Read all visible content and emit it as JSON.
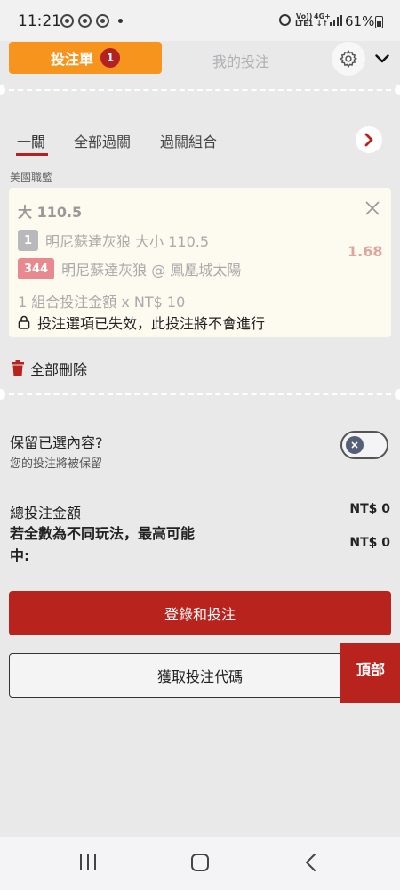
{
  "status_bar": {
    "time": "11:21",
    "network_top": "Vo))",
    "network_bottom": "LTE1",
    "data_top": "4G+",
    "data_bottom": "↓↑",
    "battery": "61%"
  },
  "header": {
    "betslip_label": "投注單",
    "betslip_count": "1",
    "mybets_label": "我的投注",
    "active_color": "#f7941d"
  },
  "bet_tabs": {
    "items": [
      "一關",
      "全部過關",
      "過關組合"
    ],
    "active_index": 0
  },
  "league": "美國職籃",
  "selection": {
    "title": "大 110.5",
    "market_number": "1",
    "market_text": "明尼蘇達灰狼 大小 110.5",
    "event_number": "344",
    "event_text": "明尼蘇達灰狼 @ 鳳凰城太陽",
    "odds": "1.68",
    "stake_line": "1 組合投注金額 x NT$ 10",
    "warning": "投注選項已失效，此投注將不會進行"
  },
  "delete_all_label": "全部刪除",
  "keep_selections": {
    "title": "保留已選內容?",
    "subtitle": "您的投注將被保留",
    "enabled": false
  },
  "summary": {
    "total_label": "總投注金額",
    "total_value": "NT$ 0",
    "max_win_label": "若全數為不同玩法，最高可能中:",
    "max_win_value": "NT$ 0"
  },
  "buttons": {
    "login_bet": "登錄和投注",
    "get_code": "獲取投注代碼",
    "to_top": "頂部"
  },
  "colors": {
    "primary_red": "#b8231d",
    "orange": "#f7941d",
    "background": "#e9e9ea"
  }
}
